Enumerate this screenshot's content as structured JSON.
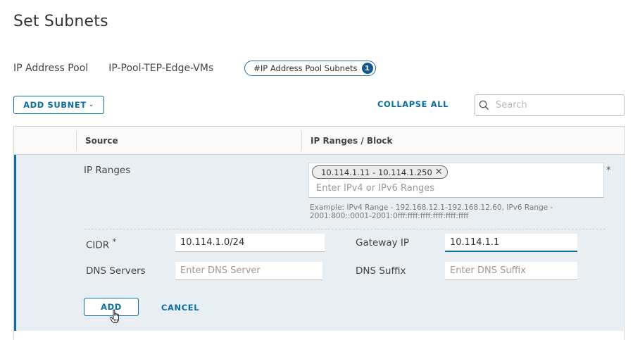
{
  "page": {
    "title": "Set Subnets"
  },
  "pool": {
    "label": "IP Address Pool",
    "name": "IP-Pool-TEP-Edge-VMs",
    "chip_label": "#IP Address Pool Subnets",
    "chip_count": "1"
  },
  "toolbar": {
    "add_subnet_label": "ADD SUBNET",
    "collapse_all_label": "COLLAPSE ALL",
    "search_placeholder": "Search"
  },
  "grid": {
    "columns": [
      "Source",
      "IP Ranges / Block"
    ]
  },
  "form": {
    "source_type": "IP Ranges",
    "range_chip": "10.114.1.11 - 10.114.1.250",
    "ranges_placeholder": "Enter IPv4 or IPv6 Ranges",
    "required_mark": "*",
    "example_text": "Example: IPv4 Range - 192.168.12.1-192.168.12.60, IPv6 Range - 2001:800::0001-2001:0fff:ffff:ffff:ffff:ffff:ffff",
    "cidr_label": "CIDR",
    "cidr_value": "10.114.1.0/24",
    "gateway_label": "Gateway IP",
    "gateway_value": "10.114.1.1",
    "dns_servers_label": "DNS Servers",
    "dns_servers_placeholder": "Enter DNS Server",
    "dns_suffix_label": "DNS Suffix",
    "dns_suffix_placeholder": "Enter DNS Suffix",
    "add_label": "ADD",
    "cancel_label": "CANCEL"
  },
  "colors": {
    "accent": "#0a6ea3",
    "badge": "#0f5a93",
    "row_background": "#e9eef2"
  },
  "icons": [
    "search-icon",
    "chevron-down-icon",
    "close-icon",
    "hand-pointer-icon"
  ]
}
